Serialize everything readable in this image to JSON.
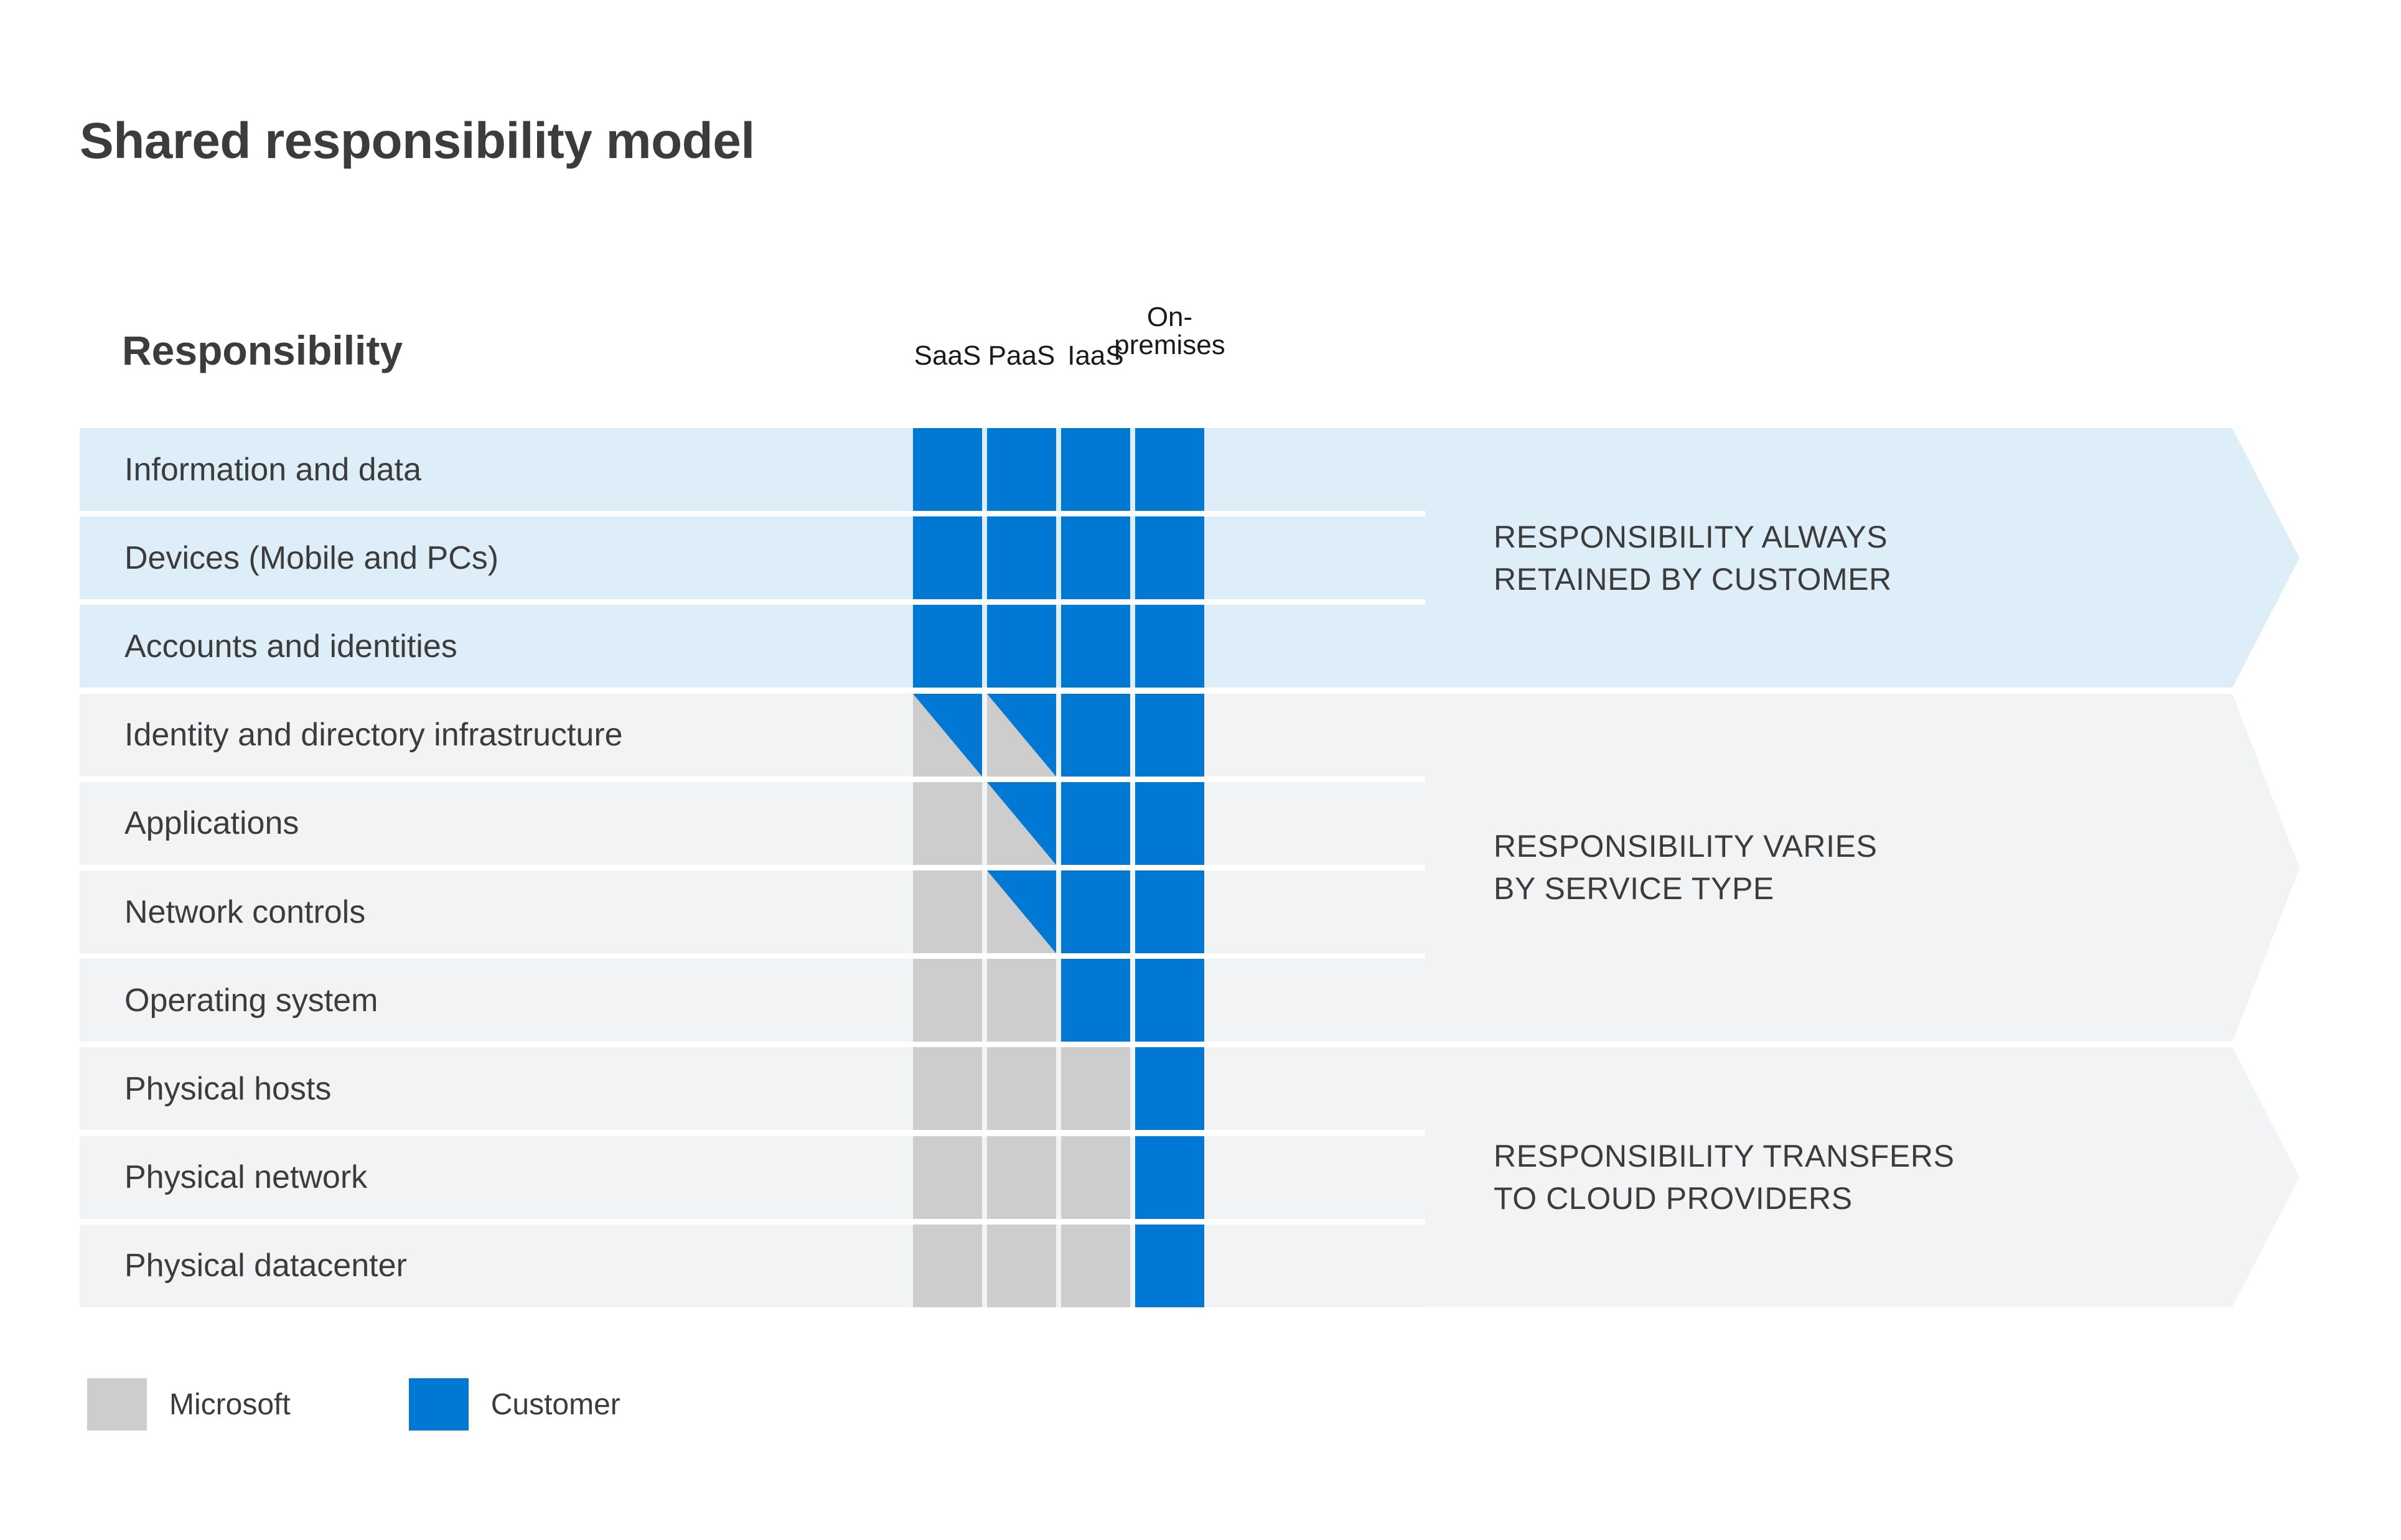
{
  "title": "Shared responsibility model",
  "colors": {
    "customer": "#0078d4",
    "microsoft": "#cdcdcd",
    "band_customer_bg": "#ddeef9",
    "band_shared_bg": "#f2f3f4",
    "row_customer_bg": "#ddeef9",
    "row_shared_bg": "#f2f3f4",
    "text": "#3c3c3c"
  },
  "table": {
    "row_header": "Responsibility",
    "column_headers": [
      {
        "label": "SaaS"
      },
      {
        "label": "PaaS"
      },
      {
        "label": "IaaS"
      },
      {
        "label": "On-\npremises"
      }
    ],
    "rows": [
      {
        "label": "Information and data",
        "cells": [
          "customer",
          "customer",
          "customer",
          "customer"
        ],
        "band": 0
      },
      {
        "label": "Devices (Mobile and PCs)",
        "cells": [
          "customer",
          "customer",
          "customer",
          "customer"
        ],
        "band": 0
      },
      {
        "label": "Accounts and identities",
        "cells": [
          "customer",
          "customer",
          "customer",
          "customer"
        ],
        "band": 0
      },
      {
        "label": "Identity and directory infrastructure",
        "cells": [
          "split",
          "split",
          "customer",
          "customer"
        ],
        "band": 1
      },
      {
        "label": "Applications",
        "cells": [
          "microsoft",
          "split",
          "customer",
          "customer"
        ],
        "band": 1
      },
      {
        "label": "Network controls",
        "cells": [
          "microsoft",
          "split",
          "customer",
          "customer"
        ],
        "band": 1
      },
      {
        "label": "Operating system",
        "cells": [
          "microsoft",
          "microsoft",
          "customer",
          "customer"
        ],
        "band": 1
      },
      {
        "label": "Physical hosts",
        "cells": [
          "microsoft",
          "microsoft",
          "microsoft",
          "customer"
        ],
        "band": 2
      },
      {
        "label": "Physical network",
        "cells": [
          "microsoft",
          "microsoft",
          "microsoft",
          "customer"
        ],
        "band": 2
      },
      {
        "label": "Physical datacenter",
        "cells": [
          "microsoft",
          "microsoft",
          "microsoft",
          "customer"
        ],
        "band": 2
      }
    ]
  },
  "bands": [
    {
      "text": "RESPONSIBILITY ALWAYS\nRETAINED BY CUSTOMER",
      "variant": "customer"
    },
    {
      "text": "RESPONSIBILITY VARIES\nBY SERVICE TYPE",
      "variant": "shared"
    },
    {
      "text": "RESPONSIBILITY TRANSFERS\nTO CLOUD PROVIDERS",
      "variant": "shared"
    }
  ],
  "legend": [
    {
      "label": "Microsoft",
      "swatch": "microsoft"
    },
    {
      "label": "Customer",
      "swatch": "customer"
    }
  ]
}
